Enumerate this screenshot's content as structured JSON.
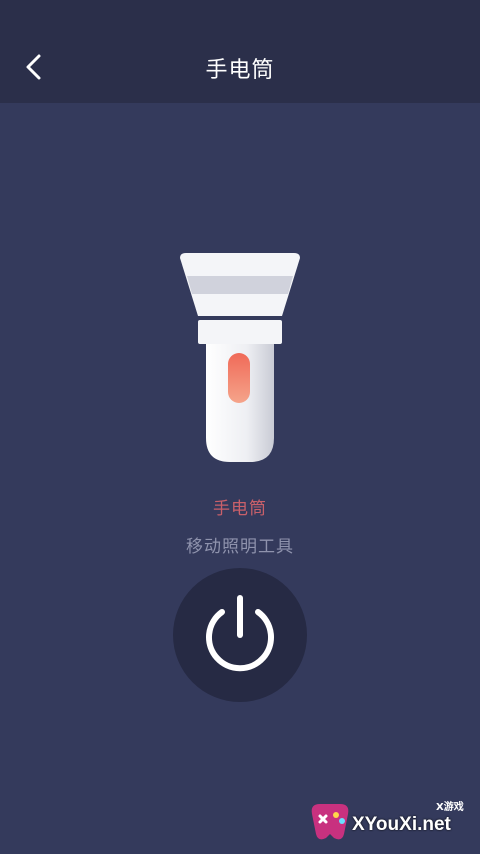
{
  "header": {
    "title": "手电筒",
    "back_icon": "chevron-left-icon"
  },
  "tool": {
    "name": "手电筒",
    "description": "移动照明工具",
    "illustration": "flashlight-icon",
    "power_icon": "power-icon"
  },
  "watermark": {
    "sub": "X游戏",
    "main": "XYouXi.net"
  },
  "colors": {
    "topbar": "#2b2f4a",
    "background": "#343a5c",
    "accent": "#c9606a",
    "power_button": "#262a44"
  }
}
